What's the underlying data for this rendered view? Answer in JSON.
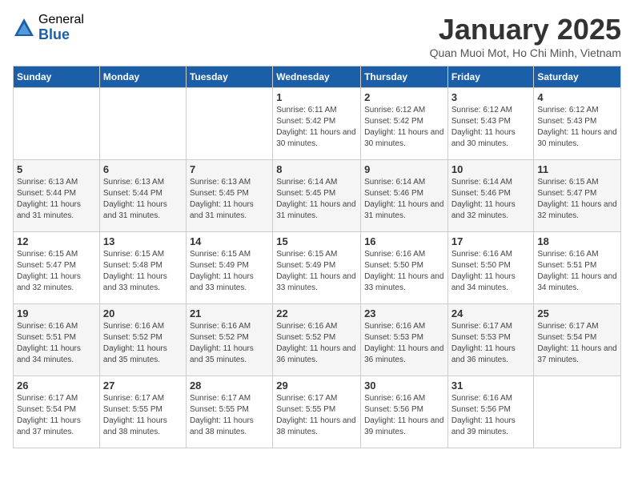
{
  "logo": {
    "general": "General",
    "blue": "Blue"
  },
  "title": "January 2025",
  "location": "Quan Muoi Mot, Ho Chi Minh, Vietnam",
  "weekdays": [
    "Sunday",
    "Monday",
    "Tuesday",
    "Wednesday",
    "Thursday",
    "Friday",
    "Saturday"
  ],
  "weeks": [
    [
      {
        "day": "",
        "sunrise": "",
        "sunset": "",
        "daylight": ""
      },
      {
        "day": "",
        "sunrise": "",
        "sunset": "",
        "daylight": ""
      },
      {
        "day": "",
        "sunrise": "",
        "sunset": "",
        "daylight": ""
      },
      {
        "day": "1",
        "sunrise": "Sunrise: 6:11 AM",
        "sunset": "Sunset: 5:42 PM",
        "daylight": "Daylight: 11 hours and 30 minutes."
      },
      {
        "day": "2",
        "sunrise": "Sunrise: 6:12 AM",
        "sunset": "Sunset: 5:42 PM",
        "daylight": "Daylight: 11 hours and 30 minutes."
      },
      {
        "day": "3",
        "sunrise": "Sunrise: 6:12 AM",
        "sunset": "Sunset: 5:43 PM",
        "daylight": "Daylight: 11 hours and 30 minutes."
      },
      {
        "day": "4",
        "sunrise": "Sunrise: 6:12 AM",
        "sunset": "Sunset: 5:43 PM",
        "daylight": "Daylight: 11 hours and 30 minutes."
      }
    ],
    [
      {
        "day": "5",
        "sunrise": "Sunrise: 6:13 AM",
        "sunset": "Sunset: 5:44 PM",
        "daylight": "Daylight: 11 hours and 31 minutes."
      },
      {
        "day": "6",
        "sunrise": "Sunrise: 6:13 AM",
        "sunset": "Sunset: 5:44 PM",
        "daylight": "Daylight: 11 hours and 31 minutes."
      },
      {
        "day": "7",
        "sunrise": "Sunrise: 6:13 AM",
        "sunset": "Sunset: 5:45 PM",
        "daylight": "Daylight: 11 hours and 31 minutes."
      },
      {
        "day": "8",
        "sunrise": "Sunrise: 6:14 AM",
        "sunset": "Sunset: 5:45 PM",
        "daylight": "Daylight: 11 hours and 31 minutes."
      },
      {
        "day": "9",
        "sunrise": "Sunrise: 6:14 AM",
        "sunset": "Sunset: 5:46 PM",
        "daylight": "Daylight: 11 hours and 31 minutes."
      },
      {
        "day": "10",
        "sunrise": "Sunrise: 6:14 AM",
        "sunset": "Sunset: 5:46 PM",
        "daylight": "Daylight: 11 hours and 32 minutes."
      },
      {
        "day": "11",
        "sunrise": "Sunrise: 6:15 AM",
        "sunset": "Sunset: 5:47 PM",
        "daylight": "Daylight: 11 hours and 32 minutes."
      }
    ],
    [
      {
        "day": "12",
        "sunrise": "Sunrise: 6:15 AM",
        "sunset": "Sunset: 5:47 PM",
        "daylight": "Daylight: 11 hours and 32 minutes."
      },
      {
        "day": "13",
        "sunrise": "Sunrise: 6:15 AM",
        "sunset": "Sunset: 5:48 PM",
        "daylight": "Daylight: 11 hours and 33 minutes."
      },
      {
        "day": "14",
        "sunrise": "Sunrise: 6:15 AM",
        "sunset": "Sunset: 5:49 PM",
        "daylight": "Daylight: 11 hours and 33 minutes."
      },
      {
        "day": "15",
        "sunrise": "Sunrise: 6:15 AM",
        "sunset": "Sunset: 5:49 PM",
        "daylight": "Daylight: 11 hours and 33 minutes."
      },
      {
        "day": "16",
        "sunrise": "Sunrise: 6:16 AM",
        "sunset": "Sunset: 5:50 PM",
        "daylight": "Daylight: 11 hours and 33 minutes."
      },
      {
        "day": "17",
        "sunrise": "Sunrise: 6:16 AM",
        "sunset": "Sunset: 5:50 PM",
        "daylight": "Daylight: 11 hours and 34 minutes."
      },
      {
        "day": "18",
        "sunrise": "Sunrise: 6:16 AM",
        "sunset": "Sunset: 5:51 PM",
        "daylight": "Daylight: 11 hours and 34 minutes."
      }
    ],
    [
      {
        "day": "19",
        "sunrise": "Sunrise: 6:16 AM",
        "sunset": "Sunset: 5:51 PM",
        "daylight": "Daylight: 11 hours and 34 minutes."
      },
      {
        "day": "20",
        "sunrise": "Sunrise: 6:16 AM",
        "sunset": "Sunset: 5:52 PM",
        "daylight": "Daylight: 11 hours and 35 minutes."
      },
      {
        "day": "21",
        "sunrise": "Sunrise: 6:16 AM",
        "sunset": "Sunset: 5:52 PM",
        "daylight": "Daylight: 11 hours and 35 minutes."
      },
      {
        "day": "22",
        "sunrise": "Sunrise: 6:16 AM",
        "sunset": "Sunset: 5:52 PM",
        "daylight": "Daylight: 11 hours and 36 minutes."
      },
      {
        "day": "23",
        "sunrise": "Sunrise: 6:16 AM",
        "sunset": "Sunset: 5:53 PM",
        "daylight": "Daylight: 11 hours and 36 minutes."
      },
      {
        "day": "24",
        "sunrise": "Sunrise: 6:17 AM",
        "sunset": "Sunset: 5:53 PM",
        "daylight": "Daylight: 11 hours and 36 minutes."
      },
      {
        "day": "25",
        "sunrise": "Sunrise: 6:17 AM",
        "sunset": "Sunset: 5:54 PM",
        "daylight": "Daylight: 11 hours and 37 minutes."
      }
    ],
    [
      {
        "day": "26",
        "sunrise": "Sunrise: 6:17 AM",
        "sunset": "Sunset: 5:54 PM",
        "daylight": "Daylight: 11 hours and 37 minutes."
      },
      {
        "day": "27",
        "sunrise": "Sunrise: 6:17 AM",
        "sunset": "Sunset: 5:55 PM",
        "daylight": "Daylight: 11 hours and 38 minutes."
      },
      {
        "day": "28",
        "sunrise": "Sunrise: 6:17 AM",
        "sunset": "Sunset: 5:55 PM",
        "daylight": "Daylight: 11 hours and 38 minutes."
      },
      {
        "day": "29",
        "sunrise": "Sunrise: 6:17 AM",
        "sunset": "Sunset: 5:55 PM",
        "daylight": "Daylight: 11 hours and 38 minutes."
      },
      {
        "day": "30",
        "sunrise": "Sunrise: 6:16 AM",
        "sunset": "Sunset: 5:56 PM",
        "daylight": "Daylight: 11 hours and 39 minutes."
      },
      {
        "day": "31",
        "sunrise": "Sunrise: 6:16 AM",
        "sunset": "Sunset: 5:56 PM",
        "daylight": "Daylight: 11 hours and 39 minutes."
      },
      {
        "day": "",
        "sunrise": "",
        "sunset": "",
        "daylight": ""
      }
    ]
  ]
}
